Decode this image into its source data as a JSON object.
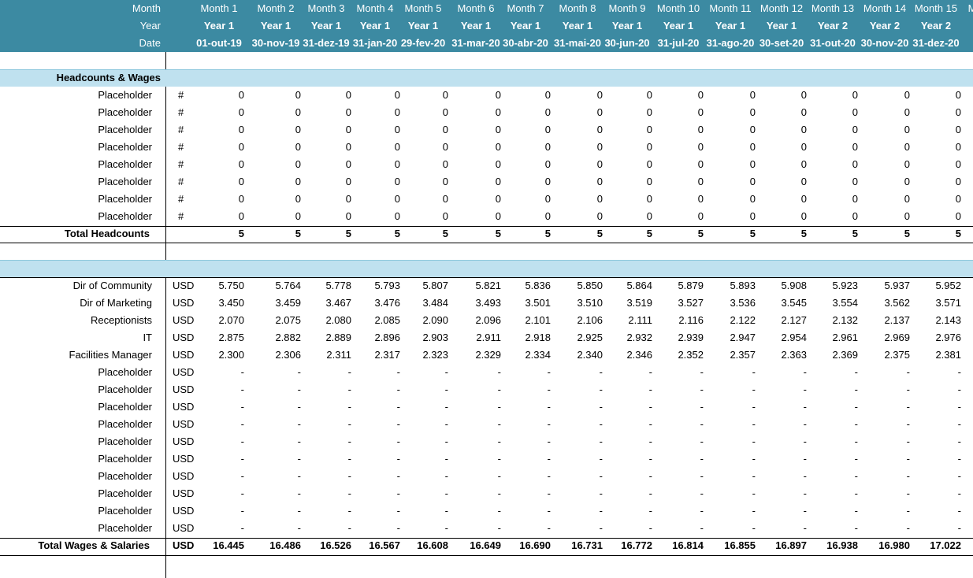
{
  "header": {
    "labels": [
      "Month",
      "Year",
      "Date"
    ],
    "months": [
      "Month 1",
      "Month 2",
      "Month 3",
      "Month 4",
      "Month 5",
      "Month 6",
      "Month 7",
      "Month 8",
      "Month 9",
      "Month 10",
      "Month 11",
      "Month 12",
      "Month 13",
      "Month 14",
      "Month 15",
      "M"
    ],
    "years": [
      "Year 1",
      "Year 1",
      "Year 1",
      "Year 1",
      "Year 1",
      "Year 1",
      "Year 1",
      "Year 1",
      "Year 1",
      "Year 1",
      "Year 1",
      "Year 1",
      "Year 2",
      "Year 2",
      "Year 2"
    ],
    "dates": [
      "01-out-19",
      "30-nov-19",
      "31-dez-19",
      "31-jan-20",
      "29-fev-20",
      "31-mar-20",
      "30-abr-20",
      "31-mai-20",
      "30-jun-20",
      "31-jul-20",
      "31-ago-20",
      "30-set-20",
      "31-out-20",
      "30-nov-20",
      "31-dez-20",
      ""
    ]
  },
  "headcounts": {
    "title": "Headcounts & Wages",
    "rows": [
      {
        "label": "Placeholder",
        "unit": "#",
        "values": [
          "0",
          "0",
          "0",
          "0",
          "0",
          "0",
          "0",
          "0",
          "0",
          "0",
          "0",
          "0",
          "0",
          "0",
          "0"
        ]
      },
      {
        "label": "Placeholder",
        "unit": "#",
        "values": [
          "0",
          "0",
          "0",
          "0",
          "0",
          "0",
          "0",
          "0",
          "0",
          "0",
          "0",
          "0",
          "0",
          "0",
          "0"
        ]
      },
      {
        "label": "Placeholder",
        "unit": "#",
        "values": [
          "0",
          "0",
          "0",
          "0",
          "0",
          "0",
          "0",
          "0",
          "0",
          "0",
          "0",
          "0",
          "0",
          "0",
          "0"
        ]
      },
      {
        "label": "Placeholder",
        "unit": "#",
        "values": [
          "0",
          "0",
          "0",
          "0",
          "0",
          "0",
          "0",
          "0",
          "0",
          "0",
          "0",
          "0",
          "0",
          "0",
          "0"
        ]
      },
      {
        "label": "Placeholder",
        "unit": "#",
        "values": [
          "0",
          "0",
          "0",
          "0",
          "0",
          "0",
          "0",
          "0",
          "0",
          "0",
          "0",
          "0",
          "0",
          "0",
          "0"
        ]
      },
      {
        "label": "Placeholder",
        "unit": "#",
        "values": [
          "0",
          "0",
          "0",
          "0",
          "0",
          "0",
          "0",
          "0",
          "0",
          "0",
          "0",
          "0",
          "0",
          "0",
          "0"
        ]
      },
      {
        "label": "Placeholder",
        "unit": "#",
        "values": [
          "0",
          "0",
          "0",
          "0",
          "0",
          "0",
          "0",
          "0",
          "0",
          "0",
          "0",
          "0",
          "0",
          "0",
          "0"
        ]
      },
      {
        "label": "Placeholder",
        "unit": "#",
        "values": [
          "0",
          "0",
          "0",
          "0",
          "0",
          "0",
          "0",
          "0",
          "0",
          "0",
          "0",
          "0",
          "0",
          "0",
          "0"
        ]
      }
    ],
    "total": {
      "label": "Total Headcounts",
      "unit": "",
      "values": [
        "5",
        "5",
        "5",
        "5",
        "5",
        "5",
        "5",
        "5",
        "5",
        "5",
        "5",
        "5",
        "5",
        "5",
        "5"
      ]
    }
  },
  "wages": {
    "title": "",
    "rows": [
      {
        "label": "Dir of Community",
        "unit": "USD",
        "values": [
          "5.750",
          "5.764",
          "5.778",
          "5.793",
          "5.807",
          "5.821",
          "5.836",
          "5.850",
          "5.864",
          "5.879",
          "5.893",
          "5.908",
          "5.923",
          "5.937",
          "5.952"
        ]
      },
      {
        "label": "Dir of Marketing",
        "unit": "USD",
        "values": [
          "3.450",
          "3.459",
          "3.467",
          "3.476",
          "3.484",
          "3.493",
          "3.501",
          "3.510",
          "3.519",
          "3.527",
          "3.536",
          "3.545",
          "3.554",
          "3.562",
          "3.571"
        ]
      },
      {
        "label": "Receptionists",
        "unit": "USD",
        "values": [
          "2.070",
          "2.075",
          "2.080",
          "2.085",
          "2.090",
          "2.096",
          "2.101",
          "2.106",
          "2.111",
          "2.116",
          "2.122",
          "2.127",
          "2.132",
          "2.137",
          "2.143"
        ]
      },
      {
        "label": "IT",
        "unit": "USD",
        "values": [
          "2.875",
          "2.882",
          "2.889",
          "2.896",
          "2.903",
          "2.911",
          "2.918",
          "2.925",
          "2.932",
          "2.939",
          "2.947",
          "2.954",
          "2.961",
          "2.969",
          "2.976"
        ]
      },
      {
        "label": "Facilities Manager",
        "unit": "USD",
        "values": [
          "2.300",
          "2.306",
          "2.311",
          "2.317",
          "2.323",
          "2.329",
          "2.334",
          "2.340",
          "2.346",
          "2.352",
          "2.357",
          "2.363",
          "2.369",
          "2.375",
          "2.381"
        ]
      },
      {
        "label": "Placeholder",
        "unit": "USD",
        "values": [
          "-",
          "-",
          "-",
          "-",
          "-",
          "-",
          "-",
          "-",
          "-",
          "-",
          "-",
          "-",
          "-",
          "-",
          "-"
        ]
      },
      {
        "label": "Placeholder",
        "unit": "USD",
        "values": [
          "-",
          "-",
          "-",
          "-",
          "-",
          "-",
          "-",
          "-",
          "-",
          "-",
          "-",
          "-",
          "-",
          "-",
          "-"
        ]
      },
      {
        "label": "Placeholder",
        "unit": "USD",
        "values": [
          "-",
          "-",
          "-",
          "-",
          "-",
          "-",
          "-",
          "-",
          "-",
          "-",
          "-",
          "-",
          "-",
          "-",
          "-"
        ]
      },
      {
        "label": "Placeholder",
        "unit": "USD",
        "values": [
          "-",
          "-",
          "-",
          "-",
          "-",
          "-",
          "-",
          "-",
          "-",
          "-",
          "-",
          "-",
          "-",
          "-",
          "-"
        ]
      },
      {
        "label": "Placeholder",
        "unit": "USD",
        "values": [
          "-",
          "-",
          "-",
          "-",
          "-",
          "-",
          "-",
          "-",
          "-",
          "-",
          "-",
          "-",
          "-",
          "-",
          "-"
        ]
      },
      {
        "label": "Placeholder",
        "unit": "USD",
        "values": [
          "-",
          "-",
          "-",
          "-",
          "-",
          "-",
          "-",
          "-",
          "-",
          "-",
          "-",
          "-",
          "-",
          "-",
          "-"
        ]
      },
      {
        "label": "Placeholder",
        "unit": "USD",
        "values": [
          "-",
          "-",
          "-",
          "-",
          "-",
          "-",
          "-",
          "-",
          "-",
          "-",
          "-",
          "-",
          "-",
          "-",
          "-"
        ]
      },
      {
        "label": "Placeholder",
        "unit": "USD",
        "values": [
          "-",
          "-",
          "-",
          "-",
          "-",
          "-",
          "-",
          "-",
          "-",
          "-",
          "-",
          "-",
          "-",
          "-",
          "-"
        ]
      },
      {
        "label": "Placeholder",
        "unit": "USD",
        "values": [
          "-",
          "-",
          "-",
          "-",
          "-",
          "-",
          "-",
          "-",
          "-",
          "-",
          "-",
          "-",
          "-",
          "-",
          "-"
        ]
      },
      {
        "label": "Placeholder",
        "unit": "USD",
        "values": [
          "-",
          "-",
          "-",
          "-",
          "-",
          "-",
          "-",
          "-",
          "-",
          "-",
          "-",
          "-",
          "-",
          "-",
          "-"
        ]
      }
    ],
    "total": {
      "label": "Total Wages & Salaries",
      "unit": "USD",
      "values": [
        "16.445",
        "16.486",
        "16.526",
        "16.567",
        "16.608",
        "16.649",
        "16.690",
        "16.731",
        "16.772",
        "16.814",
        "16.855",
        "16.897",
        "16.938",
        "16.980",
        "17.022"
      ]
    }
  }
}
